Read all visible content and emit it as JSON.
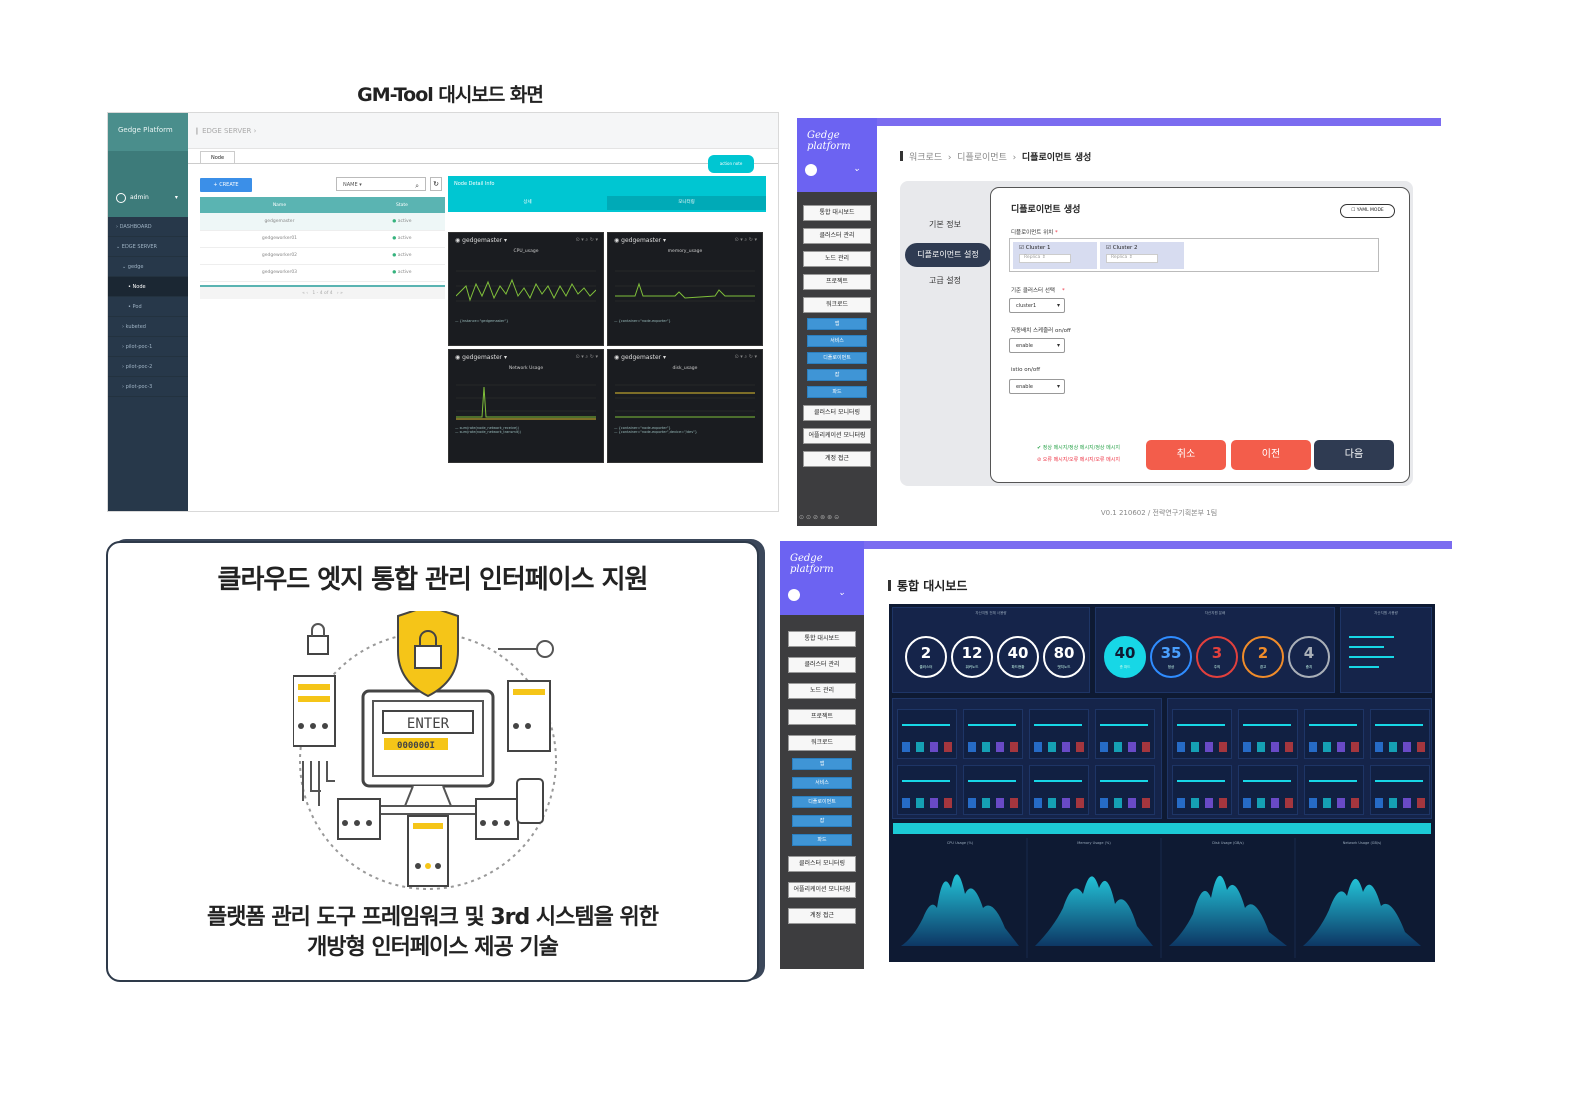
{
  "captions": {
    "gm_tool": "GM-Tool 대시보드 화면"
  },
  "gm_tool": {
    "logo": "Gedge Platform",
    "user": "admin",
    "nav": [
      "DASHBOARD",
      "EDGE SERVER",
      "gedge",
      "Node",
      "Pod",
      "kubeted",
      "pilot-poc-1",
      "pilot-poc-2",
      "pilot-poc-3"
    ],
    "breadcrumb": "EDGE SERVER",
    "tab": "Node",
    "create_label": "+ CREATE",
    "select_value": "NAME",
    "columns": [
      "Name",
      "State"
    ],
    "rows": [
      {
        "name": "gedgemaster",
        "state": "active"
      },
      {
        "name": "gedgeworker01",
        "state": "active"
      },
      {
        "name": "gedgeworker02",
        "state": "active"
      },
      {
        "name": "gedgeworker03",
        "state": "active"
      }
    ],
    "pager": "1 - 4 of 4",
    "detail_title": "Node Detail Info",
    "detail_tabs": [
      "상세",
      "모니터링"
    ],
    "monitor_badge": "action note",
    "graphs": [
      {
        "host": "gedgemaster",
        "title": "CPU_usage"
      },
      {
        "host": "gedgemaster",
        "title": "memory_usage"
      },
      {
        "host": "gedgemaster",
        "title": "Network Usage"
      },
      {
        "host": "gedgemaster",
        "title": "disk_usage"
      }
    ]
  },
  "deploy": {
    "brand": "Gedge platform",
    "menu": [
      "통합 대시보드",
      "클러스터 관리",
      "노드 관리",
      "프로젝트",
      "워크로드"
    ],
    "submenu": [
      "앱",
      "서비스",
      "디플로이먼트",
      "잡",
      "파드"
    ],
    "menu2": [
      "클러스터 모니터링",
      "어플리케이션 모니터링",
      "계정 접근"
    ],
    "breadcrumb": [
      "워크로드",
      "디플로이먼트",
      "디플로이먼트 생성"
    ],
    "steps": [
      "기본 정보",
      "디플로이먼트 설정",
      "고급 설정"
    ],
    "form_title": "디플로이먼트 생성",
    "yaml_mode": "YAML MODE",
    "location_label": "디플로이먼트 위치",
    "clusters": [
      "Cluster 1",
      "Cluster 2"
    ],
    "replica_placeholder": "Replica ⇕",
    "base_cluster_label": "기준 클러스터 선택",
    "base_cluster_value": "cluster1",
    "autoscale_label": "자동배치 스케줄러 on/off",
    "autoscale_value": "enable",
    "istio_label": "istio on/off",
    "istio_value": "enable",
    "msg_ok": "정상 메시지/정상 메시지/정상 메시지",
    "msg_err": "오류 메시지/오류 메시지/오류 메시지",
    "btn_cancel": "취소",
    "btn_prev": "이전",
    "btn_next": "다음",
    "version": "V0.1 210602 / 전략연구기획본부 1팀"
  },
  "illustration": {
    "title": "클라우드 엣지 통합 관리 인터페이스 지원",
    "enter_label": "ENTER",
    "code": "000000I",
    "subtitle_1": "플랫폼 관리 도구 프레임워크 및 3rd 시스템을 위한",
    "subtitle_2": "개방형 인터페이스 제공 기술"
  },
  "dashboard": {
    "brand": "Gedge platform",
    "title": "통합 대시보드",
    "menu": [
      "통합 대시보드",
      "클러스터 관리",
      "노드 관리",
      "프로젝트",
      "워크로드"
    ],
    "submenu": [
      "앱",
      "서비스",
      "디플로이먼트",
      "잡",
      "파드"
    ],
    "menu2": [
      "클러스터 모니터링",
      "어플리케이션 모니터링",
      "계정 접근"
    ],
    "block1_title": "자산지원 전체 사용량",
    "rings1": [
      {
        "value": "2",
        "label": "클러스터"
      },
      {
        "value": "12",
        "label": "워커노드"
      },
      {
        "value": "40",
        "label": "파드현황"
      },
      {
        "value": "80",
        "label": "엣지노드"
      }
    ],
    "block2_title": "자산지원 분배",
    "rings2": [
      {
        "value": "40",
        "label": "총 파드",
        "color": "#17d7e6"
      },
      {
        "value": "35",
        "label": "정상",
        "color": "#2f8cff"
      },
      {
        "value": "3",
        "label": "주의",
        "color": "#e2403d"
      },
      {
        "value": "2",
        "label": "경고",
        "color": "#f08c2a"
      },
      {
        "value": "4",
        "label": "중지",
        "color": "#aab0b8"
      }
    ],
    "block3_title": "자산지원 사용량",
    "charts": [
      "CPU Usage (%)",
      "Memory Usage (%)",
      "Disk Usage (GB/s)",
      "Network Usage (GB/s)"
    ]
  }
}
